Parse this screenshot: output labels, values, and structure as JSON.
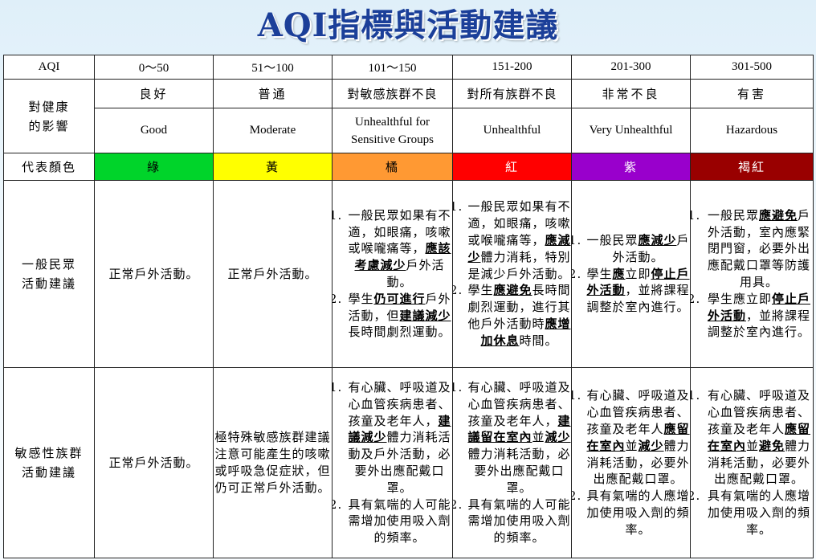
{
  "title": "AQI指標與活動建議",
  "header": {
    "aqi_label": "AQI",
    "ranges": [
      "0～50",
      "51～100",
      "101～150",
      "151-200",
      "201-300",
      "301-500"
    ]
  },
  "health": {
    "label": "對健康\n的影響",
    "zh": [
      "良好",
      "普通",
      "對敏感族群不良",
      "對所有族群不良",
      "非常不良",
      "有害"
    ],
    "en": [
      "Good",
      "Moderate",
      "Unhealthful for Sensitive Groups",
      "Unhealthful",
      "Very Unhealthful",
      "Hazardous"
    ]
  },
  "colors": {
    "label": "代表顏色",
    "names": [
      "綠",
      "黃",
      "橘",
      "紅",
      "紫",
      "褐紅"
    ],
    "hex": [
      "#00d42a",
      "#ffff00",
      "#ff9933",
      "#ff0000",
      "#9900cc",
      "#990000"
    ],
    "text_hex": [
      "#000000",
      "#000000",
      "#000000",
      "#ffffff",
      "#ffffff",
      "#ffffff"
    ]
  },
  "general": {
    "label": "一般民眾\n活動建議",
    "cells": [
      {
        "text": "正常戶外活動。"
      },
      {
        "text": "正常戶外活動。"
      },
      {
        "items": [
          [
            {
              "t": "一般民眾如果有不適，如眼痛，咳嗽或喉嚨痛等，"
            },
            {
              "t": "應該考慮減少",
              "u": true
            },
            {
              "t": "戶外活動。"
            }
          ],
          [
            {
              "t": "學生"
            },
            {
              "t": "仍可進行",
              "u": true
            },
            {
              "t": "戶外活動，但"
            },
            {
              "t": "建議減少",
              "u": true
            },
            {
              "t": "長時間劇烈運動。"
            }
          ]
        ]
      },
      {
        "items": [
          [
            {
              "t": "一般民眾如果有不適，如眼痛，咳嗽或喉嚨痛等，"
            },
            {
              "t": "應減少",
              "u": true
            },
            {
              "t": "體力消耗，特別是減少戶外活動。"
            }
          ],
          [
            {
              "t": "學生"
            },
            {
              "t": "應避免",
              "u": true
            },
            {
              "t": "長時間劇烈運動，進行其他戶外活動時"
            },
            {
              "t": "應增加休息",
              "u": true
            },
            {
              "t": "時間。"
            }
          ]
        ]
      },
      {
        "items": [
          [
            {
              "t": "一般民眾"
            },
            {
              "t": "應減少",
              "u": true
            },
            {
              "t": "戶外活動。"
            }
          ],
          [
            {
              "t": "學生"
            },
            {
              "t": "應",
              "u": true
            },
            {
              "t": "立即"
            },
            {
              "t": "停止戶外活動",
              "u": true
            },
            {
              "t": "，並將課程調整於室內進行。"
            }
          ]
        ]
      },
      {
        "items": [
          [
            {
              "t": "一般民眾"
            },
            {
              "t": "應避免",
              "u": true
            },
            {
              "t": "戶外活動，室內應緊閉門窗，必要外出應配戴口罩等防護用具。"
            }
          ],
          [
            {
              "t": "學生應立即"
            },
            {
              "t": "停止戶外活動",
              "u": true
            },
            {
              "t": "，並將課程調整於室內進行。"
            }
          ]
        ]
      }
    ]
  },
  "sensitive": {
    "label": "敏感性族群\n活動建議",
    "cells": [
      {
        "text": "正常戶外活動。"
      },
      {
        "text": "極特殊敏感族群建議注意可能產生的咳嗽或呼吸急促症狀，但仍可正常戶外活動。"
      },
      {
        "items": [
          [
            {
              "t": "有心臟、呼吸道及心血管疾病患者、孩童及老年人，"
            },
            {
              "t": "建議減少",
              "u": true
            },
            {
              "t": "體力消耗活動及戶外活動，必要外出應配戴口罩。"
            }
          ],
          [
            {
              "t": "具有氣喘的人可能需增加使用吸入劑的頻率。"
            }
          ]
        ]
      },
      {
        "items": [
          [
            {
              "t": "有心臟、呼吸道及心血管疾病患者、孩童及老年人，"
            },
            {
              "t": "建議留在室內",
              "u": true
            },
            {
              "t": "並"
            },
            {
              "t": "減少",
              "u": true
            },
            {
              "t": "體力消耗活動，必要外出應配戴口罩。"
            }
          ],
          [
            {
              "t": "具有氣喘的人可能需增加使用吸入劑的頻率。"
            }
          ]
        ]
      },
      {
        "items": [
          [
            {
              "t": "有心臟、呼吸道及心血管疾病患者、孩童及老年人"
            },
            {
              "t": "應留在室內",
              "u": true
            },
            {
              "t": "並"
            },
            {
              "t": "減少",
              "u": true
            },
            {
              "t": "體力消耗活動，必要外出應配戴口罩。"
            }
          ],
          [
            {
              "t": "具有氣喘的人應增加使用吸入劑的頻率。"
            }
          ]
        ]
      },
      {
        "items": [
          [
            {
              "t": "有心臟、呼吸道及心血管疾病患者、孩童及老年人"
            },
            {
              "t": "應留在室內",
              "u": true
            },
            {
              "t": "並"
            },
            {
              "t": "避免",
              "u": true
            },
            {
              "t": "體力消耗活動，必要外出應配戴口罩。"
            }
          ],
          [
            {
              "t": "具有氣喘的人應增加使用吸入劑的頻率。"
            }
          ]
        ]
      }
    ]
  }
}
